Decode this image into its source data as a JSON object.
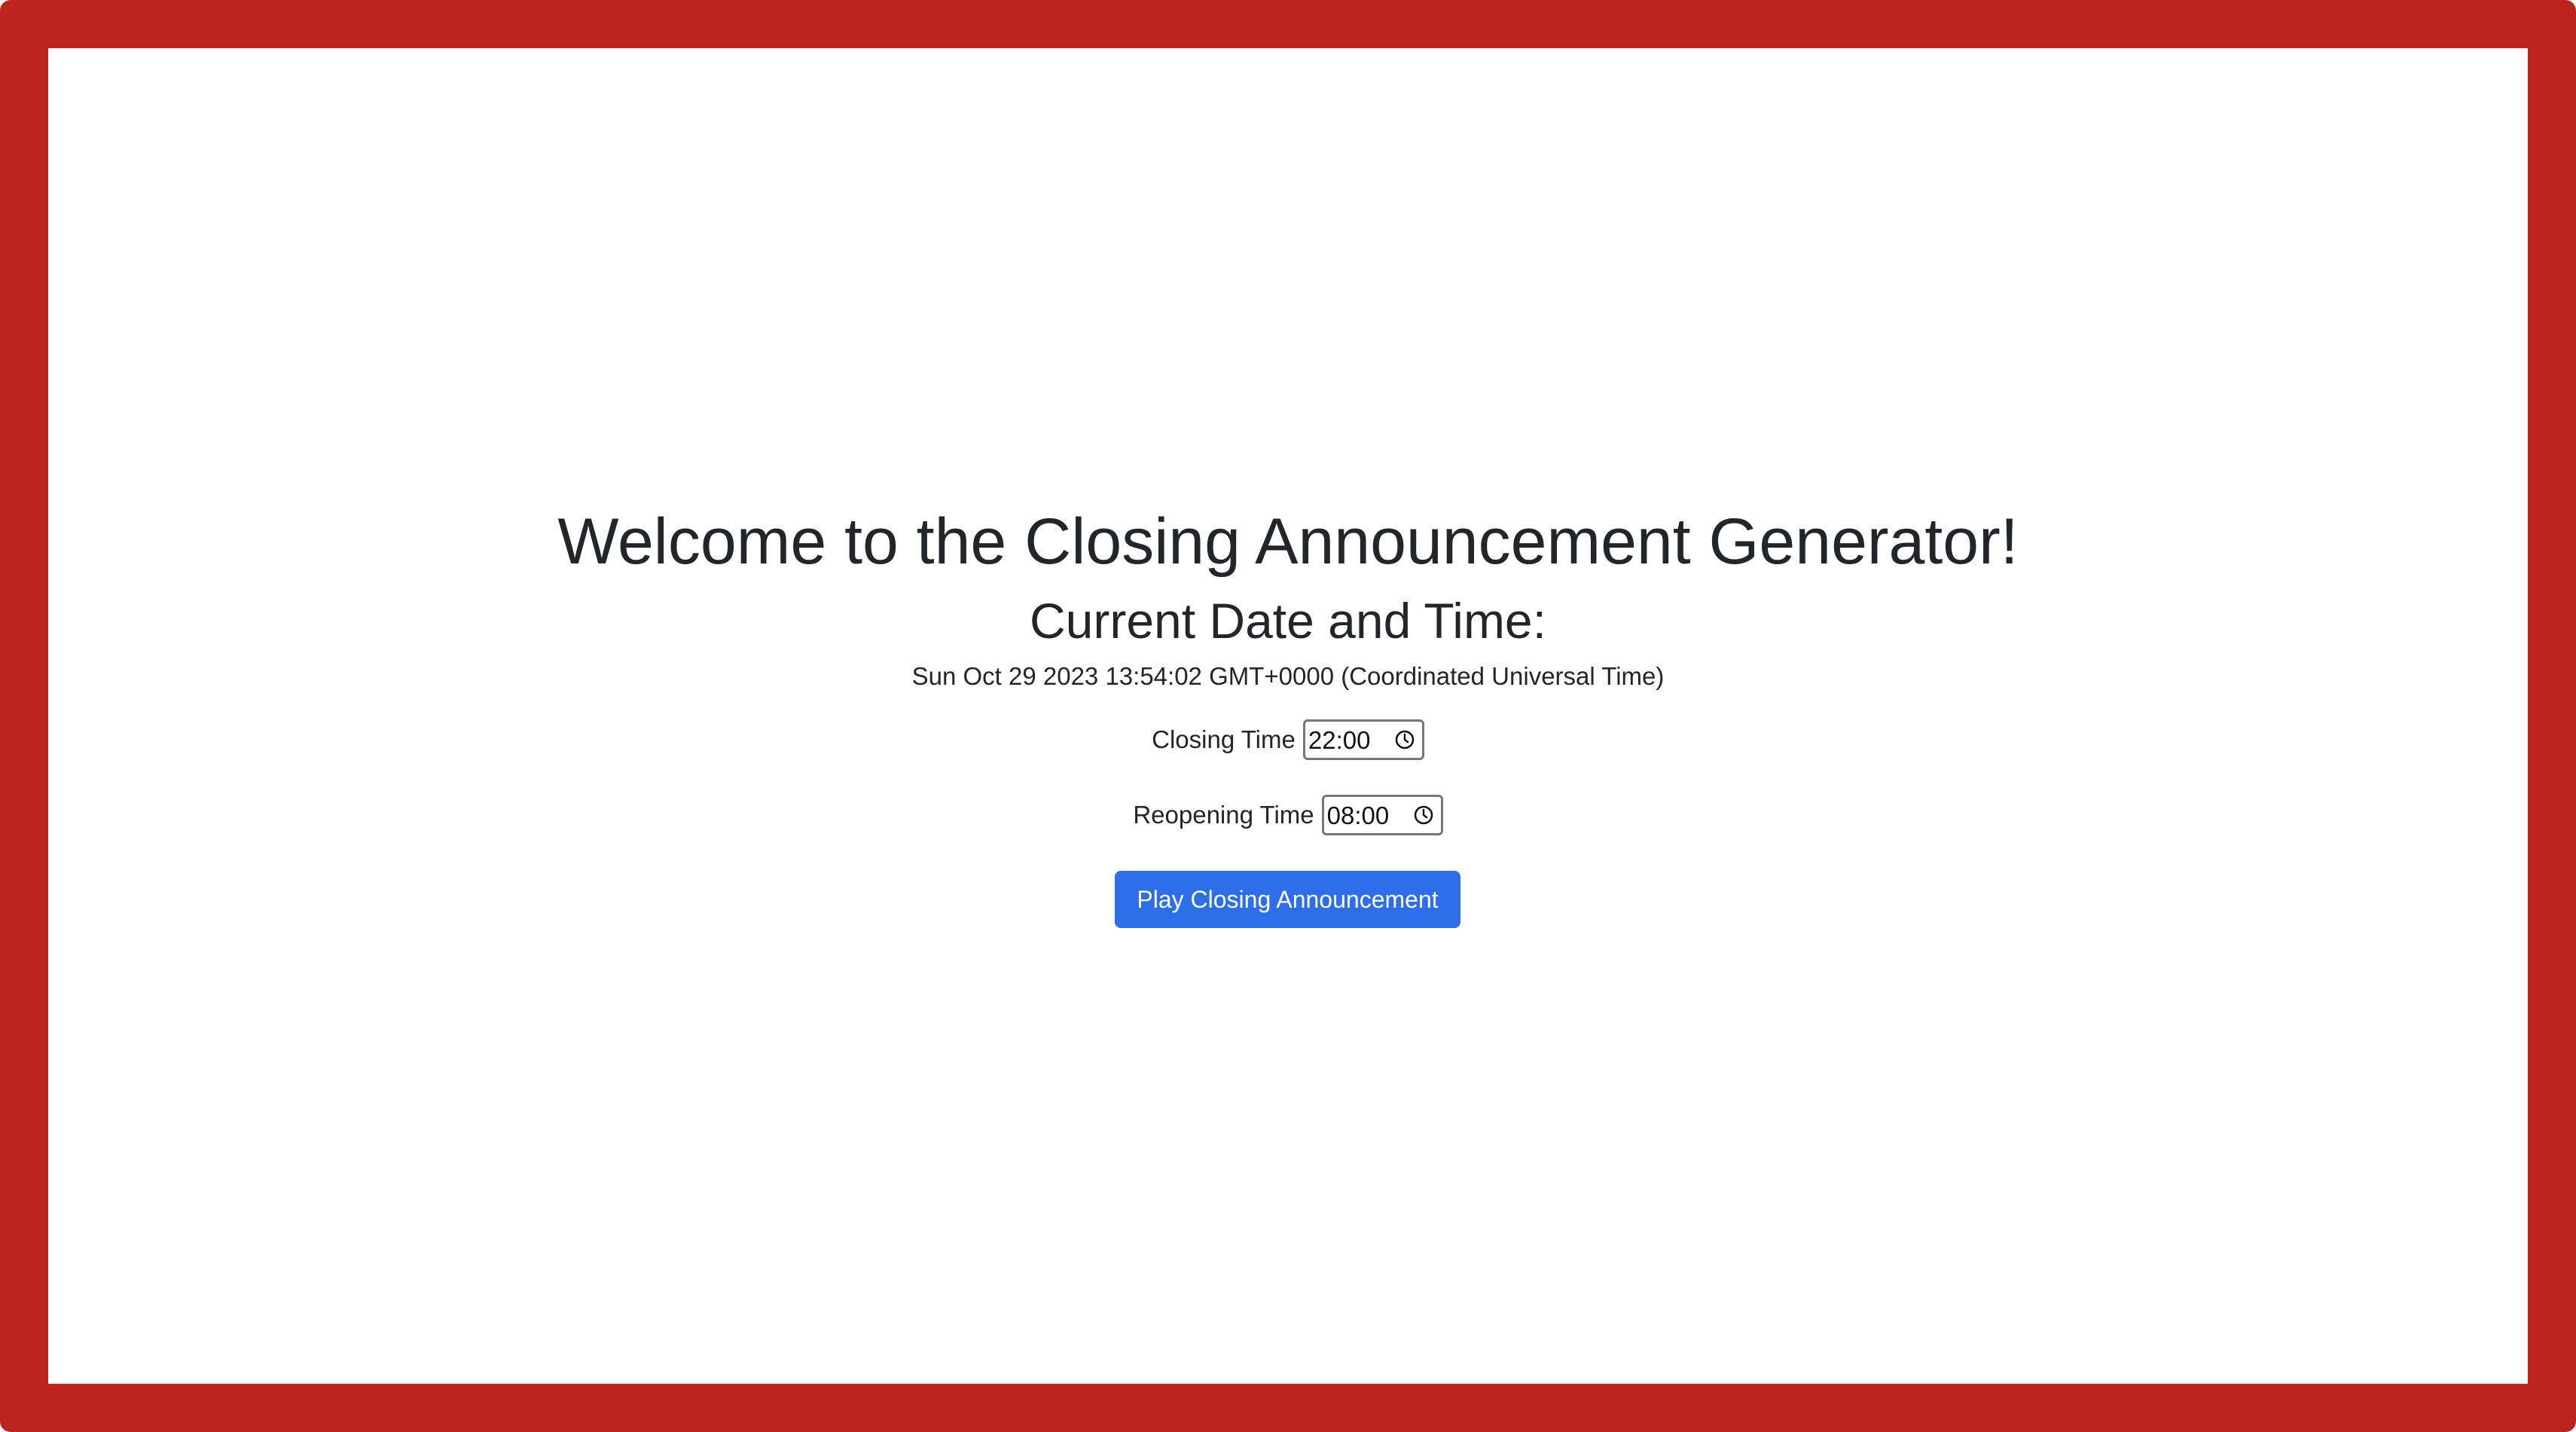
{
  "header": {
    "title": "Welcome to the Closing Announcement Generator!"
  },
  "current": {
    "heading": "Current Date and Time:",
    "datetime": "Sun Oct 29 2023 13:54:02 GMT+0000 (Coordinated Universal Time)"
  },
  "closing_time": {
    "label": "Closing Time",
    "value": "22:00",
    "icon": "clock-icon"
  },
  "reopening_time": {
    "label": "Reopening Time",
    "value": "08:00",
    "icon": "clock-icon"
  },
  "actions": {
    "play_label": "Play Closing Announcement"
  },
  "colors": {
    "frame": "#bb251e",
    "button": "#2d6eea",
    "text": "#222529"
  }
}
